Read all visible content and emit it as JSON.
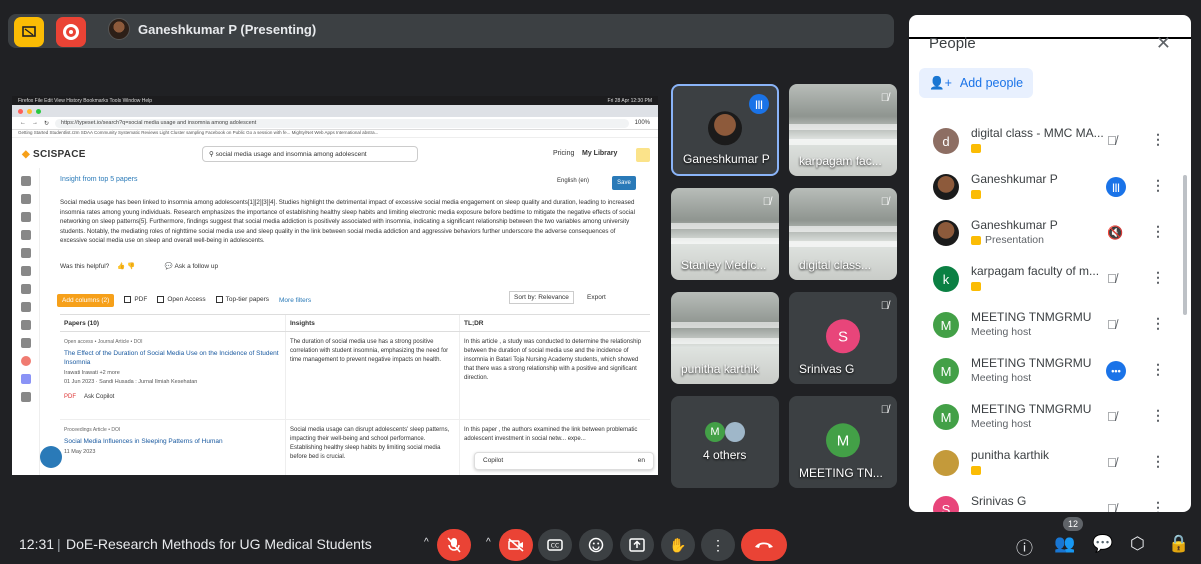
{
  "presenter": {
    "label": "Ganeshkumar P (Presenting)"
  },
  "share": {
    "mac_menu": "Firefox  File  Edit  View  History  Bookmarks  Tools  Window  Help",
    "mac_clock": "Fri 28 Apr  12:30 PM",
    "url": "https://typeset.io/search?q=social media usage and insomnia among adolescent",
    "zoom": "100%",
    "bookmarks": "Getting Started   Studentlist.r2m   SDAA   Community   Systematic Reviews   Light   Cluster sampling   Facebook on Public   Go a session with fe...   Mighty/Net Web Apps   International abstra...",
    "logo": "SCISPACE",
    "search_query": "social media usage and insomnia among adolescent",
    "pricing": "Pricing",
    "library": "My Library",
    "insight_head": "Insight from top",
    "insight_papers": "5 papers",
    "language": "English (en)",
    "save": "Save",
    "insight_text": "Social media usage has been linked to insomnia among adolescents[1][2][3][4]. Studies highlight the detrimental impact of excessive social media engagement on sleep quality and duration, leading to increased insomnia rates among young individuals. Research emphasizes the importance of establishing healthy sleep habits and limiting electronic media exposure before bedtime to mitigate the negative effects of social networking on sleep patterns[5]. Furthermore, findings suggest that social media addiction is positively associated with insomnia, indicating a significant relationship between the two variables among university students. Notably, the mediating roles of nighttime social media use and sleep quality in the link between social media addiction and aggressive behaviors further underscore the adverse consequences of excessive social media use on sleep and overall well-being in adolescents.",
    "helpful": "Was this helpful?",
    "follow_up": "Ask a follow up",
    "add_columns": "Add columns (2)",
    "filter_pdf": "PDF",
    "filter_open": "Open Access",
    "filter_top": "Top-tier papers",
    "more_filters": "More filters",
    "sort": "Sort by: Relevance",
    "export": "Export",
    "col_papers": "Papers (10)",
    "col_insights": "Insights",
    "col_tldr": "TL;DR",
    "row1_meta": "Open access • Journal Article • DOI",
    "row1_title": "The Effect of the Duration of Social Media Use on the Incidence of Student Insomnia",
    "row1_authors": "Irawati Irawati +2 more",
    "row1_date": "01 Jun 2023 · Sandi Husada : Jurnal Ilmiah Kesehatan",
    "row1_pdf": "PDF",
    "row1_copilot": "Ask Copilot",
    "row1_insight": "The duration of social media use has a strong positive correlation with student insomnia, emphasizing the need for time management to prevent negative impacts on health.",
    "row1_tldr": "In this article , a study was conducted to determine the relationship between the duration of social media use and the incidence of insomnia in Batari Toja Nursing Academy students, which showed that there was a strong relationship with a positive and significant direction.",
    "row2_meta": "Proceedings Article • DOI",
    "row2_title": "Social Media Influences in Sleeping Patterns of Human",
    "row2_date": "11 May 2023",
    "row2_insight": "Social media usage can disrupt adolescents' sleep patterns, impacting their well-being and school performance. Establishing healthy sleep habits by limiting social media before bed is crucial.",
    "row2_tldr": "In this paper , the authors examined the link between problematic adolescent investment in social netw... expe...",
    "copilot": "Copilot",
    "copilot_lang": "en"
  },
  "tiles": [
    {
      "name": "Ganeshkumar P"
    },
    {
      "name": "karpagam fac..."
    },
    {
      "name": "Stanley Medic..."
    },
    {
      "name": "digital class..."
    },
    {
      "name": "punitha karthik"
    },
    {
      "name": "Srinivas G",
      "initial": "S"
    },
    {
      "name": "4 others",
      "initial": "M"
    },
    {
      "name": "MEETING TN...",
      "initial": "M"
    }
  ],
  "people": {
    "title": "People",
    "add_people": "Add people",
    "list": [
      {
        "name": "digital class - MMC MA...",
        "initial": "d",
        "color": "#8d6e63",
        "sub": ""
      },
      {
        "name": "Ganeshkumar P",
        "initial": "",
        "color": "#3c3c3c",
        "sub": ""
      },
      {
        "name": "Ganeshkumar P",
        "initial": "",
        "color": "#3c3c3c",
        "sub": "Presentation"
      },
      {
        "name": "karpagam faculty of m...",
        "initial": "k",
        "color": "#0b8043",
        "sub": ""
      },
      {
        "name": "MEETING TNMGRMU",
        "initial": "M",
        "color": "#43a047",
        "sub": "Meeting host"
      },
      {
        "name": "MEETING TNMGRMU",
        "initial": "M",
        "color": "#43a047",
        "sub": "Meeting host"
      },
      {
        "name": "MEETING TNMGRMU",
        "initial": "M",
        "color": "#43a047",
        "sub": "Meeting host"
      },
      {
        "name": "punitha karthik",
        "initial": "",
        "color": "#c49a3a",
        "sub": ""
      },
      {
        "name": "Srinivas G",
        "initial": "S",
        "color": "#e8457a",
        "sub": ""
      }
    ]
  },
  "bottom": {
    "time": "12:31",
    "separator": "|",
    "meeting": "DoE-Research Methods for UG Medical Students",
    "participants_count": "12"
  }
}
